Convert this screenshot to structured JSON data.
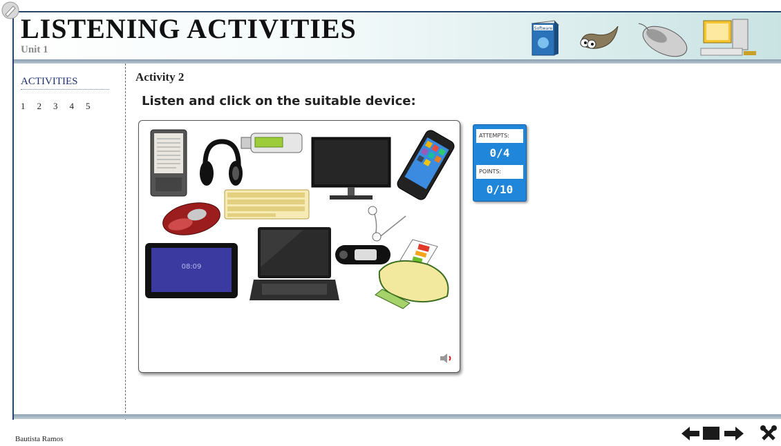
{
  "header": {
    "title": "LISTENING ACTIVITIES",
    "subtitle": "Unit 1",
    "icons": [
      "software-box-icon",
      "gimp-mascot-icon",
      "mouse-icon",
      "desktop-computer-icon"
    ],
    "software_box_label": "Software"
  },
  "sidebar": {
    "heading": "ACTIVITIES",
    "links": [
      "1",
      "2",
      "3",
      "4",
      "5"
    ]
  },
  "activity": {
    "title": "Activity 2",
    "instruction": "Listen and click on the suitable device:",
    "devices": [
      "e-reader",
      "headphones",
      "usb-drive",
      "monitor",
      "smartphone",
      "mouse",
      "keyboard",
      "earphones",
      "tablet",
      "laptop",
      "mp3-player",
      "printer"
    ],
    "tablet_clock": "08:09"
  },
  "score": {
    "attempts_label": "ATTEMPTS:",
    "attempts_value": "0/4",
    "points_label": "POINTS:",
    "points_value": "0/10"
  },
  "footer": {
    "author": "Bautista Ramos",
    "nav_icons": [
      "arrow-left-icon",
      "screen-icon",
      "arrow-right-icon",
      "close-tools-icon"
    ]
  },
  "colors": {
    "accent": "#1f86d9",
    "frame": "#26456d",
    "link": "#1b2f6b"
  }
}
